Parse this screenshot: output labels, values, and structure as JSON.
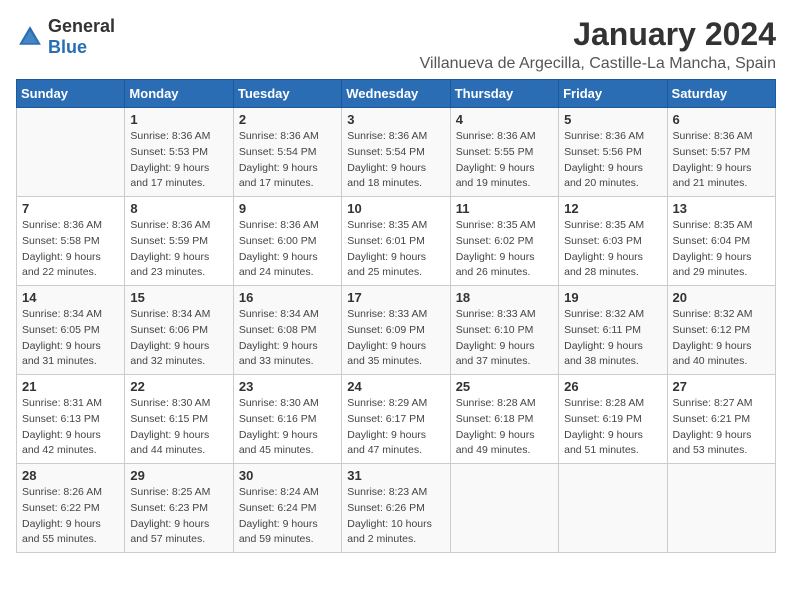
{
  "header": {
    "logo_general": "General",
    "logo_blue": "Blue",
    "month_title": "January 2024",
    "location": "Villanueva de Argecilla, Castille-La Mancha, Spain"
  },
  "calendar": {
    "days_of_week": [
      "Sunday",
      "Monday",
      "Tuesday",
      "Wednesday",
      "Thursday",
      "Friday",
      "Saturday"
    ],
    "weeks": [
      [
        {
          "day": "",
          "info": ""
        },
        {
          "day": "1",
          "info": "Sunrise: 8:36 AM\nSunset: 5:53 PM\nDaylight: 9 hours\nand 17 minutes."
        },
        {
          "day": "2",
          "info": "Sunrise: 8:36 AM\nSunset: 5:54 PM\nDaylight: 9 hours\nand 17 minutes."
        },
        {
          "day": "3",
          "info": "Sunrise: 8:36 AM\nSunset: 5:54 PM\nDaylight: 9 hours\nand 18 minutes."
        },
        {
          "day": "4",
          "info": "Sunrise: 8:36 AM\nSunset: 5:55 PM\nDaylight: 9 hours\nand 19 minutes."
        },
        {
          "day": "5",
          "info": "Sunrise: 8:36 AM\nSunset: 5:56 PM\nDaylight: 9 hours\nand 20 minutes."
        },
        {
          "day": "6",
          "info": "Sunrise: 8:36 AM\nSunset: 5:57 PM\nDaylight: 9 hours\nand 21 minutes."
        }
      ],
      [
        {
          "day": "7",
          "info": "Sunrise: 8:36 AM\nSunset: 5:58 PM\nDaylight: 9 hours\nand 22 minutes."
        },
        {
          "day": "8",
          "info": "Sunrise: 8:36 AM\nSunset: 5:59 PM\nDaylight: 9 hours\nand 23 minutes."
        },
        {
          "day": "9",
          "info": "Sunrise: 8:36 AM\nSunset: 6:00 PM\nDaylight: 9 hours\nand 24 minutes."
        },
        {
          "day": "10",
          "info": "Sunrise: 8:35 AM\nSunset: 6:01 PM\nDaylight: 9 hours\nand 25 minutes."
        },
        {
          "day": "11",
          "info": "Sunrise: 8:35 AM\nSunset: 6:02 PM\nDaylight: 9 hours\nand 26 minutes."
        },
        {
          "day": "12",
          "info": "Sunrise: 8:35 AM\nSunset: 6:03 PM\nDaylight: 9 hours\nand 28 minutes."
        },
        {
          "day": "13",
          "info": "Sunrise: 8:35 AM\nSunset: 6:04 PM\nDaylight: 9 hours\nand 29 minutes."
        }
      ],
      [
        {
          "day": "14",
          "info": "Sunrise: 8:34 AM\nSunset: 6:05 PM\nDaylight: 9 hours\nand 31 minutes."
        },
        {
          "day": "15",
          "info": "Sunrise: 8:34 AM\nSunset: 6:06 PM\nDaylight: 9 hours\nand 32 minutes."
        },
        {
          "day": "16",
          "info": "Sunrise: 8:34 AM\nSunset: 6:08 PM\nDaylight: 9 hours\nand 33 minutes."
        },
        {
          "day": "17",
          "info": "Sunrise: 8:33 AM\nSunset: 6:09 PM\nDaylight: 9 hours\nand 35 minutes."
        },
        {
          "day": "18",
          "info": "Sunrise: 8:33 AM\nSunset: 6:10 PM\nDaylight: 9 hours\nand 37 minutes."
        },
        {
          "day": "19",
          "info": "Sunrise: 8:32 AM\nSunset: 6:11 PM\nDaylight: 9 hours\nand 38 minutes."
        },
        {
          "day": "20",
          "info": "Sunrise: 8:32 AM\nSunset: 6:12 PM\nDaylight: 9 hours\nand 40 minutes."
        }
      ],
      [
        {
          "day": "21",
          "info": "Sunrise: 8:31 AM\nSunset: 6:13 PM\nDaylight: 9 hours\nand 42 minutes."
        },
        {
          "day": "22",
          "info": "Sunrise: 8:30 AM\nSunset: 6:15 PM\nDaylight: 9 hours\nand 44 minutes."
        },
        {
          "day": "23",
          "info": "Sunrise: 8:30 AM\nSunset: 6:16 PM\nDaylight: 9 hours\nand 45 minutes."
        },
        {
          "day": "24",
          "info": "Sunrise: 8:29 AM\nSunset: 6:17 PM\nDaylight: 9 hours\nand 47 minutes."
        },
        {
          "day": "25",
          "info": "Sunrise: 8:28 AM\nSunset: 6:18 PM\nDaylight: 9 hours\nand 49 minutes."
        },
        {
          "day": "26",
          "info": "Sunrise: 8:28 AM\nSunset: 6:19 PM\nDaylight: 9 hours\nand 51 minutes."
        },
        {
          "day": "27",
          "info": "Sunrise: 8:27 AM\nSunset: 6:21 PM\nDaylight: 9 hours\nand 53 minutes."
        }
      ],
      [
        {
          "day": "28",
          "info": "Sunrise: 8:26 AM\nSunset: 6:22 PM\nDaylight: 9 hours\nand 55 minutes."
        },
        {
          "day": "29",
          "info": "Sunrise: 8:25 AM\nSunset: 6:23 PM\nDaylight: 9 hours\nand 57 minutes."
        },
        {
          "day": "30",
          "info": "Sunrise: 8:24 AM\nSunset: 6:24 PM\nDaylight: 9 hours\nand 59 minutes."
        },
        {
          "day": "31",
          "info": "Sunrise: 8:23 AM\nSunset: 6:26 PM\nDaylight: 10 hours\nand 2 minutes."
        },
        {
          "day": "",
          "info": ""
        },
        {
          "day": "",
          "info": ""
        },
        {
          "day": "",
          "info": ""
        }
      ]
    ]
  }
}
